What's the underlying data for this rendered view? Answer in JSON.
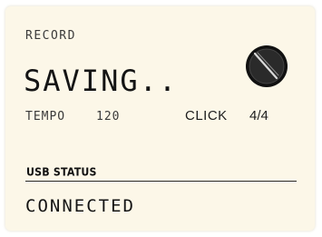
{
  "record": {
    "label": "RECORD",
    "status": "SAVING.."
  },
  "tempo": {
    "label": "TEMPO",
    "value": "120"
  },
  "click": {
    "label": "CLICK",
    "value": "4/4"
  },
  "usb": {
    "heading": "USB STATUS",
    "value": "CONNECTED"
  },
  "icons": {
    "knob": "rotary-knob-icon"
  },
  "colors": {
    "panel_background": "#fcf7e8",
    "text": "#1d1d1d",
    "knob": "#111111"
  }
}
